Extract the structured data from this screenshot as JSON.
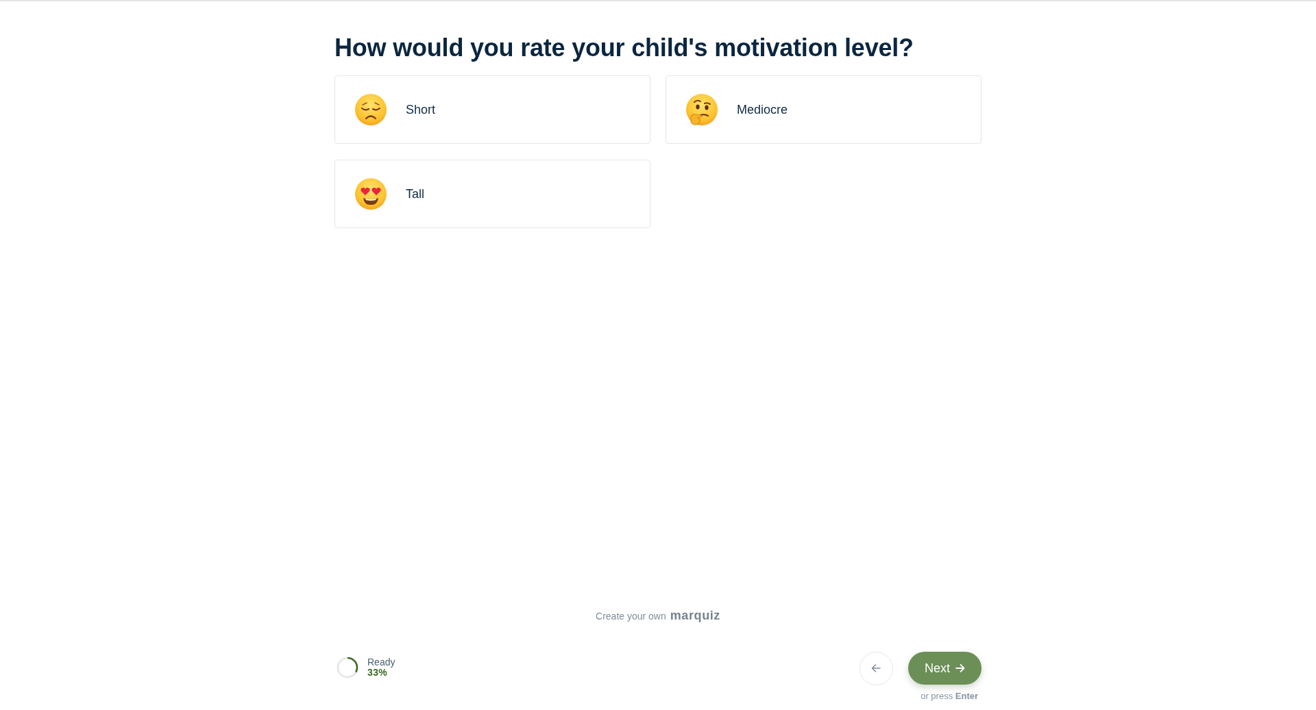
{
  "question": {
    "title": "How would you rate your child's motivation level?"
  },
  "options": [
    {
      "label": "Short",
      "kind": "sad",
      "selected": false
    },
    {
      "label": "Mediocre",
      "kind": "thinking",
      "selected": false
    },
    {
      "label": "Tall",
      "kind": "love",
      "selected": false
    }
  ],
  "branding": {
    "text": "Create your own",
    "logo": "marquiz"
  },
  "progress": {
    "label": "Ready",
    "percent": "33%",
    "level": 0.33
  },
  "navigation": {
    "next": {
      "label": "Next"
    },
    "hint": "or press **Enter**"
  }
}
